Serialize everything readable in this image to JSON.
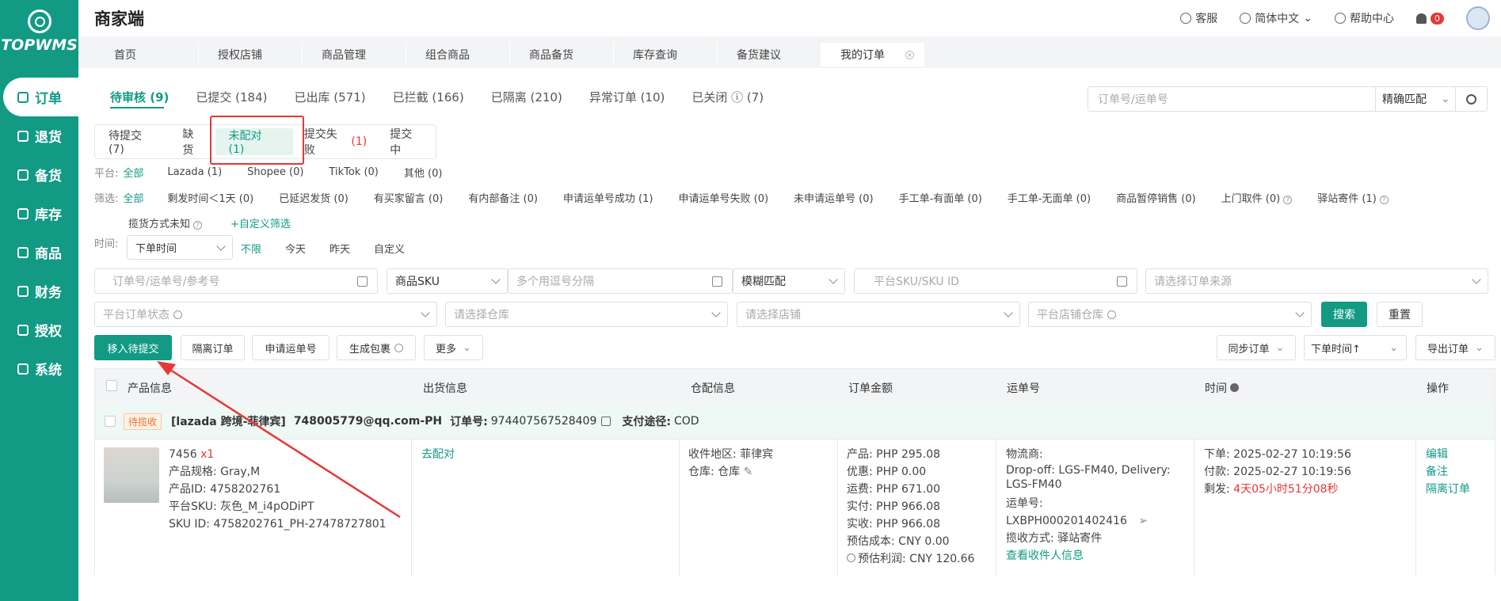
{
  "app": {
    "logo_text": "TOPWMS",
    "title": "商家端"
  },
  "top_right": {
    "service": "客服",
    "language": "简体中文",
    "help": "帮助中心",
    "notification_count": "0"
  },
  "sidebar": {
    "items": [
      {
        "label": "订单",
        "icon": "order-icon",
        "active": true
      },
      {
        "label": "退货",
        "icon": "return-icon"
      },
      {
        "label": "备货",
        "icon": "stock-icon"
      },
      {
        "label": "库存",
        "icon": "inventory-icon"
      },
      {
        "label": "商品",
        "icon": "product-icon"
      },
      {
        "label": "财务",
        "icon": "finance-icon"
      },
      {
        "label": "授权",
        "icon": "auth-icon"
      },
      {
        "label": "系统",
        "icon": "system-icon"
      }
    ]
  },
  "page_tabs": [
    "首页",
    "授权店铺",
    "商品管理",
    "组合商品",
    "商品备货",
    "库存查询",
    "备货建议",
    "我的订单"
  ],
  "status_tabs": [
    {
      "label": "待审核 (9)",
      "active": true
    },
    {
      "label": "已提交 (184)"
    },
    {
      "label": "已出库 (571)"
    },
    {
      "label": "已拦截 (166)"
    },
    {
      "label": "已隔离 (210)"
    },
    {
      "label": "异常订单 (10)"
    },
    {
      "label": "已关闭 ⓘ (7)"
    }
  ],
  "top_search": {
    "placeholder": "订单号/运单号",
    "match": "精确匹配"
  },
  "sub_tabs": [
    {
      "label": "待提交 (7)"
    },
    {
      "label": "缺货"
    },
    {
      "label": "未配对 (1)",
      "active": true
    },
    {
      "label": "提交失败",
      "count": "(1)"
    },
    {
      "label": "提交中"
    }
  ],
  "platform": {
    "label": "平台:",
    "options": [
      "全部",
      "Lazada (1)",
      "Shopee (0)",
      "TikTok (0)",
      "其他 (0)"
    ]
  },
  "filter": {
    "label": "筛选:",
    "options": [
      "全部",
      "剩发时间＜1天 (0)",
      "已延迟发货 (0)",
      "有买家留言 (0)",
      "有内部备注 (0)",
      "申请运单号成功 (1)",
      "申请运单号失败 (0)",
      "未申请运单号 (0)",
      "手工单-有面单 (0)",
      "手工单-无面单 (0)",
      "商品暂停销售 (0)",
      "上门取件 (0)",
      "驿站寄件 (1)"
    ],
    "row2": "揽货方式未知",
    "custom": "+自定义筛选"
  },
  "time": {
    "label": "时间:",
    "select": "下单时间",
    "options": [
      "不限",
      "今天",
      "昨天",
      "自定义"
    ]
  },
  "search_form": {
    "order_placeholder": "订单号/运单号/参考号",
    "sku_type": "商品SKU",
    "multi_placeholder": "多个用逗号分隔",
    "fuzzy": "模糊匹配",
    "platform_sku_placeholder": "平台SKU/SKU ID",
    "source_placeholder": "请选择订单来源",
    "platform_status_placeholder": "平台订单状态",
    "warehouse_placeholder": "请选择仓库",
    "store_placeholder": "请选择店铺",
    "platform_warehouse_placeholder": "平台店铺仓库",
    "search_btn": "搜索",
    "reset_btn": "重置"
  },
  "actions": {
    "move": "移入待提交",
    "isolate": "隔离订单",
    "apply": "申请运单号",
    "package": "生成包裹",
    "more": "更多",
    "sync": "同步订单",
    "sort": "下单时间↑",
    "export": "导出订单"
  },
  "table_headers": [
    "产品信息",
    "出货信息",
    "仓配信息",
    "订单金额",
    "运单号",
    "时间",
    "操作"
  ],
  "order": {
    "tag": "待揽收",
    "store": "[lazada 跨境-菲律宾]",
    "email": "748005779@qq.com-PH",
    "order_no_label": "订单号:",
    "order_no": "974407567528409",
    "pay_label": "支付途径:",
    "pay": "COD",
    "product": {
      "name": "7456",
      "qty": "x1",
      "spec": "产品规格: Gray,M",
      "pid": "产品ID: 4758202761",
      "psku": "平台SKU: 灰色_M_i4pODiPT",
      "skuid": "SKU ID: 4758202761_PH-27478727801"
    },
    "shipping_link": "去配对",
    "region": "收件地区: 菲律宾",
    "warehouse": "仓库: 仓库",
    "amounts": [
      "产品: PHP 295.08",
      "优惠: PHP 0.00",
      "运费: PHP 671.00",
      "实付: PHP 966.08",
      "实收: PHP 966.08",
      "预估成本: CNY 0.00",
      "预估利润: CNY 120.66"
    ],
    "logistics_label": "物流商:",
    "logistics": "Drop-off: LGS-FM40, Delivery: LGS-FM40",
    "waybill_label": "运单号:",
    "waybill": "LXBPH000201402416",
    "pickup": "揽收方式: 驿站寄件",
    "receiver_link": "查看收件人信息",
    "time_order": "下单: 2025-02-27 10:19:56",
    "time_pay": "付款: 2025-02-27 10:19:56",
    "time_left_label": "剩发:",
    "time_left": "4天05小时51分08秒",
    "ops": [
      "编辑",
      "备注",
      "隔离订单"
    ]
  }
}
